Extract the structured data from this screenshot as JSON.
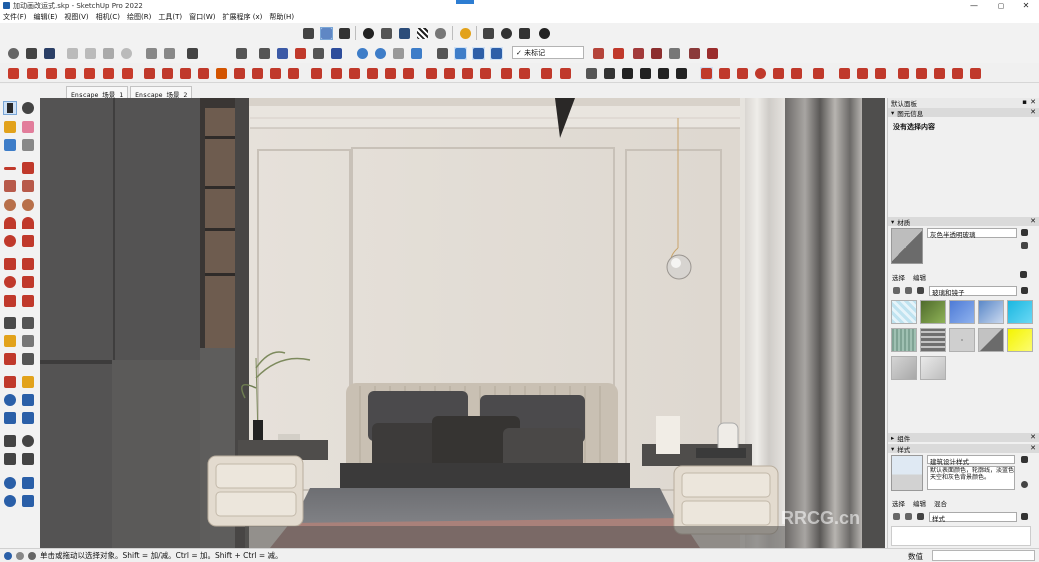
{
  "window": {
    "title": "加动画改运式.skp - SketchUp Pro 2022",
    "minimize": "—",
    "maximize": "▢",
    "close": "✕"
  },
  "menu": [
    "文件(F)",
    "编辑(E)",
    "视图(V)",
    "相机(C)",
    "绘图(R)",
    "工具(T)",
    "窗口(W)",
    "扩展程序 (x)",
    "帮助(H)"
  ],
  "toolbar": {
    "tag_dropdown": "✓ 未标记"
  },
  "scenes": [
    "Enscape 场景 1",
    "Enscape 场景 2"
  ],
  "status": {
    "text": "单击或拖动以选择对象。Shift = 加/减。Ctrl = 加。Shift + Ctrl = 减。",
    "measure_label": "数值"
  },
  "panels": {
    "tray_title": "默认面板",
    "entity_info": {
      "title": "图元信息",
      "empty": "没有选择内容"
    },
    "materials": {
      "title": "材质",
      "current_name": "灰色半透明玻璃",
      "tab_select": "选择",
      "tab_edit": "编辑",
      "collection": "玻璃和镜子"
    },
    "components": {
      "title": "组件"
    },
    "styles": {
      "title": "样式",
      "style_name": "建筑设计样式",
      "style_desc": "默认表面颜色，轮廓线，淡蓝色天空和灰色背景颜色。",
      "tab_select": "选择",
      "tab_edit": "编辑",
      "tab_mix": "混合",
      "collection": "样式"
    }
  },
  "watermark": "RRCG.cn",
  "icon_names": [
    "select-icon",
    "orbit-icon",
    "eraser-icon",
    "paint-bucket-icon",
    "line-icon",
    "rectangle-icon",
    "circle-icon",
    "arc-icon",
    "move-icon",
    "rotate-icon",
    "scale-icon",
    "offset-icon",
    "tape-measure-icon",
    "text-icon",
    "zoom-icon",
    "zoom-extents-icon",
    "walk-icon",
    "look-around-icon",
    "section-plane-icon"
  ]
}
